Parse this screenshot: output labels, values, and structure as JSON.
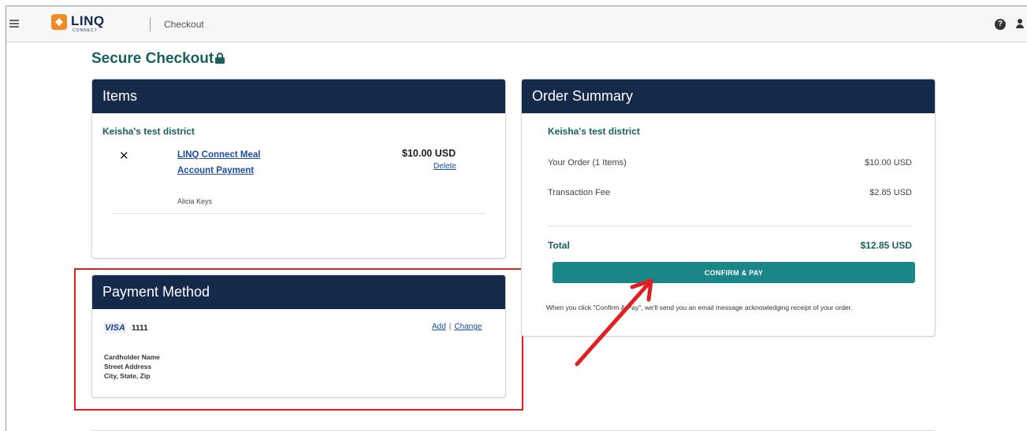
{
  "header": {
    "logo_text": "LINQ",
    "logo_sub": "CONNECT",
    "breadcrumb": "Checkout",
    "help_symbol": "?"
  },
  "page": {
    "title": "Secure Checkout"
  },
  "items": {
    "heading": "Items",
    "district": "Keisha's test district",
    "list": [
      {
        "name": "LINQ Connect Meal Account Payment",
        "student": "Alicia Keys",
        "price": "$10.00 USD",
        "delete_label": "Delete"
      }
    ]
  },
  "payment": {
    "heading": "Payment Method",
    "card_brand": "VISA",
    "card_last4": "1111",
    "add_label": "Add",
    "change_label": "Change",
    "separator": "|",
    "cardholder": "Cardholder Name",
    "street": "Street Address",
    "city_state_zip": "City, State, Zip"
  },
  "summary": {
    "heading": "Order Summary",
    "district": "Keisha's test district",
    "order_label": "Your Order (1 Items)",
    "order_value": "$10.00 USD",
    "fee_label": "Transaction Fee",
    "fee_value": "$2.85 USD",
    "total_label": "Total",
    "total_value": "$12.85 USD",
    "confirm_label": "CONFIRM & PAY",
    "note": "When you click \"Confirm & Pay\", we'll send you an email message acknowledging receipt of your order."
  },
  "colors": {
    "header_navy": "#15294a",
    "accent_teal": "#17615e",
    "button_teal": "#1a8688",
    "link_blue": "#1b4ea0",
    "annotation_red": "#e02020",
    "logo_orange": "#f08a24"
  }
}
